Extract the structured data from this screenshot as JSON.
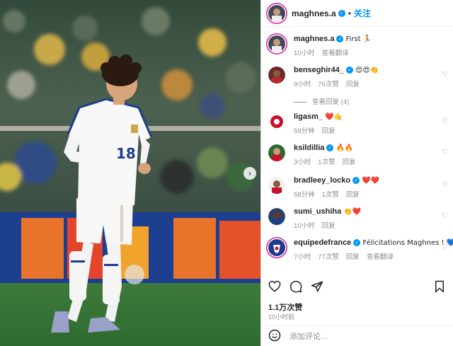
{
  "post": {
    "author": "maghnes.a",
    "follow_label": "关注",
    "likes": "1.1万次赞",
    "time": "10小时前",
    "add_comment_placeholder": "添加评论...",
    "carousel_next_glyph": "›"
  },
  "comments": [
    {
      "user": "maghnes.a",
      "verified": true,
      "text": "First 🏃",
      "time": "10小时",
      "likes": "",
      "reply": "",
      "translate": "查看翻译"
    },
    {
      "user": "benseghir44_",
      "verified": true,
      "text": "😍😍👏",
      "time": "9小时",
      "likes": "76次赞",
      "reply": "回复",
      "translate": ""
    },
    {
      "user": "ligasm_",
      "verified": false,
      "text": "❤️🤙",
      "time": "59分钟",
      "likes": "",
      "reply": "回复",
      "translate": ""
    },
    {
      "user": "ksildillia",
      "verified": true,
      "text": "🔥🔥",
      "time": "3小时",
      "likes": "1次赞",
      "reply": "回复",
      "translate": ""
    },
    {
      "user": "bradleey_locko",
      "verified": true,
      "text": "❤️❤️",
      "time": "58分钟",
      "likes": "1次赞",
      "reply": "回复",
      "translate": ""
    },
    {
      "user": "sumi_ushiha",
      "verified": false,
      "text": "👏❤️",
      "time": "10小时",
      "likes": "",
      "reply": "回复",
      "translate": ""
    },
    {
      "user": "equipedefrance",
      "verified": true,
      "text": "Félicitations Maghnes ! 💙",
      "time": "7小时",
      "likes": "77次赞",
      "reply": "回复",
      "translate": "查看翻译"
    }
  ],
  "view_replies": "查看回复 (4)",
  "colors": {
    "link": "#0095f6",
    "meta": "#8e8e8e",
    "verified": "#0095f6",
    "heart_red": "#ed4956"
  }
}
